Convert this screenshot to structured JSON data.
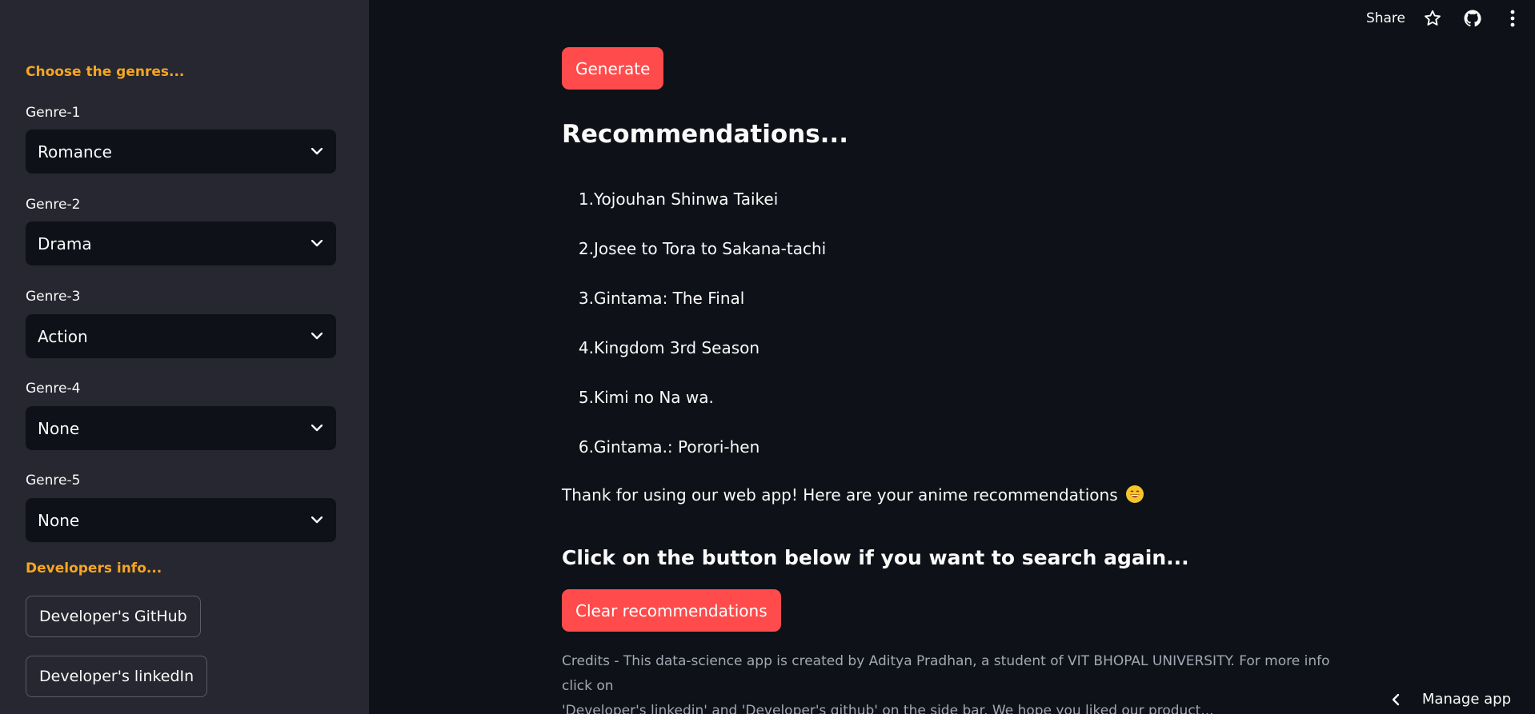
{
  "sidebar": {
    "heading_genres": "Choose the genres...",
    "genres": [
      {
        "label": "Genre-1",
        "value": "Romance"
      },
      {
        "label": "Genre-2",
        "value": "Drama"
      },
      {
        "label": "Genre-3",
        "value": "Action"
      },
      {
        "label": "Genre-4",
        "value": "None"
      },
      {
        "label": "Genre-5",
        "value": "None"
      }
    ],
    "heading_dev": "Developers info...",
    "github_button": "Developer's GitHub",
    "linkedin_button": "Developer's linkedIn",
    "heading_color": "#f5a623"
  },
  "toolbar": {
    "share_label": "Share",
    "icons": [
      "star-icon",
      "github-icon",
      "more-vertical-icon"
    ]
  },
  "main": {
    "generate_button": "Generate",
    "recommendations_heading": "Recommendations...",
    "recommendations": [
      {
        "num": "1.",
        "title": "Yojouhan Shinwa Taikei"
      },
      {
        "num": "2.",
        "title": "Josee to Tora to Sakana-tachi"
      },
      {
        "num": "3.",
        "title": "Gintama: The Final"
      },
      {
        "num": "4.",
        "title": "Kingdom 3rd Season"
      },
      {
        "num": "5.",
        "title": "Kimi no Na wa."
      },
      {
        "num": "6.",
        "title": "Gintama.: Porori-hen"
      }
    ],
    "thanks_text": "Thank for using our web app! Here are your anime recommendations",
    "search_again_heading": "Click on the button below if you want to search again...",
    "clear_button": "Clear recommendations",
    "credits_line1": "Credits - This data-science app is created by Aditya Pradhan, a student of VIT BHOPAL UNIVERSITY. For more info click on",
    "credits_line2": "'Developer's linkedin' and 'Developer's github' on the side bar. We hope you liked our product...",
    "accent_color": "#ff4b4b"
  },
  "footer": {
    "manage_app": "Manage app"
  }
}
